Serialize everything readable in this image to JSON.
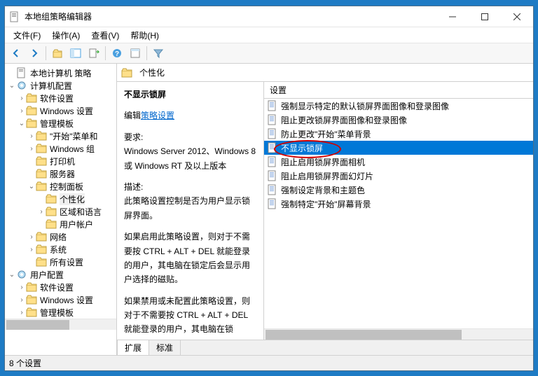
{
  "window": {
    "title": "本地组策略编辑器"
  },
  "menus": {
    "file": "文件(F)",
    "action": "操作(A)",
    "view": "查看(V)",
    "help": "帮助(H)"
  },
  "tree": {
    "root": "本地计算机 策略",
    "computer": "计算机配置",
    "soft1": "软件设置",
    "winset1": "Windows 设置",
    "admintpl1": "管理模板",
    "startmenu": "\"开始\"菜单和",
    "wincomp": "Windows 组",
    "printer": "打印机",
    "server": "服务器",
    "ctrlpanel": "控制面板",
    "personal": "个性化",
    "region": "区域和语言",
    "useracct": "用户帐户",
    "network": "网络",
    "system": "系统",
    "allset": "所有设置",
    "user": "用户配置",
    "soft2": "软件设置",
    "winset2": "Windows 设置",
    "admintpl2": "管理模板"
  },
  "crumb": {
    "folder": "个性化"
  },
  "detail": {
    "title": "不显示锁屏",
    "edit_prefix": "编辑",
    "edit_link": "策略设置",
    "req_label": "要求:",
    "req_text": "Windows Server 2012、Windows 8 或 Windows RT 及以上版本",
    "desc_label": "描述:",
    "desc_text": "此策略设置控制是否为用户显示锁屏界面。",
    "enable_text": "如果启用此策略设置，则对于不需要按 CTRL + ALT + DEL  就能登录的用户，其电脑在锁定后会显示用户选择的磁贴。",
    "disable_text": "如果禁用或未配置此策略设置，则对于不需要按 CTRL + ALT + DEL  就能登录的用户，其电脑在锁"
  },
  "listheader": "设置",
  "items": [
    "强制显示特定的默认锁屏界面图像和登录图像",
    "阻止更改锁屏界面图像和登录图像",
    "防止更改\"开始\"菜单背景",
    "不显示锁屏",
    "阻止启用锁屏界面相机",
    "阻止启用锁屏界面幻灯片",
    "强制设定背景和主题色",
    "强制特定\"开始\"屏幕背景"
  ],
  "selected_index": 3,
  "tabs": {
    "extended": "扩展",
    "standard": "标准"
  },
  "status": "8 个设置"
}
